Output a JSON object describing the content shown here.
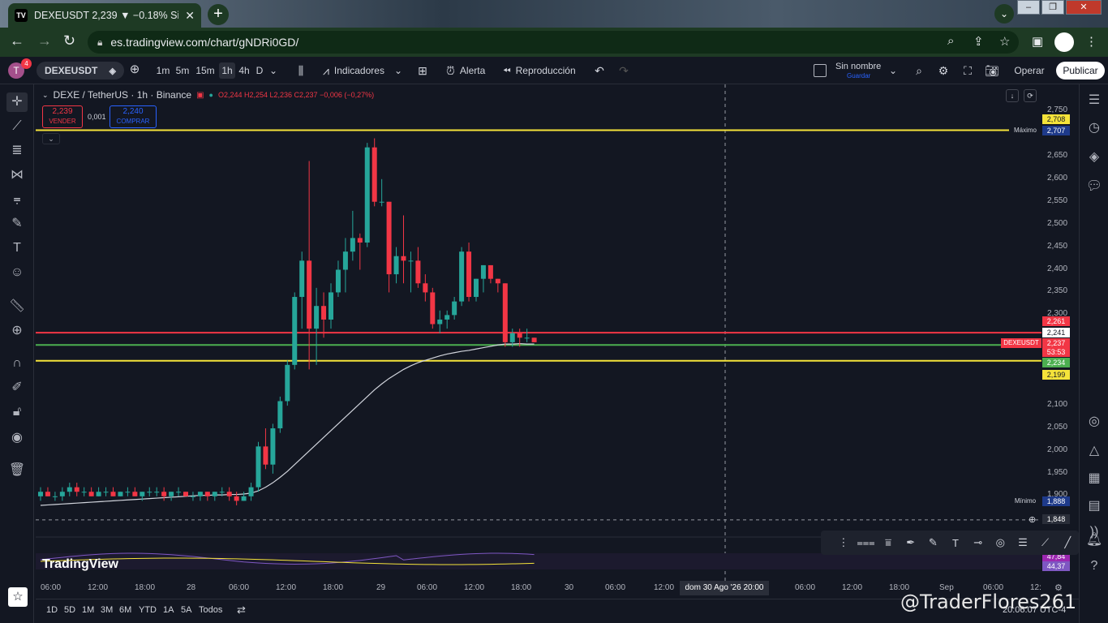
{
  "browser": {
    "tab_title": "DEXEUSDT 2,239 ▼ −0.18% Sin n",
    "url": "es.tradingview.com/chart/gNDRi0GD/"
  },
  "toolbar": {
    "avatar_letter": "T",
    "notifications": "4",
    "symbol": "DEXEUSDT",
    "timeframes": [
      "1m",
      "5m",
      "15m",
      "1h",
      "4h",
      "D"
    ],
    "indicators_label": "Indicadores",
    "alert_label": "Alerta",
    "replay_label": "Reproducción",
    "layout_name": "Sin nombre",
    "layout_save": "Guardar",
    "operar_label": "Operar",
    "publicar_label": "Publicar"
  },
  "legend": {
    "symbol": "DEXE / TetherUS · 1h · Binance",
    "ohlc": "O2,244 H2,254 L2,236 C2,237 −0,006 (−0,27%)",
    "sell_price": "2,239",
    "sell_label": "VENDER",
    "spread": "0,001",
    "buy_price": "2,240",
    "buy_label": "COMPRAR"
  },
  "price_axis": {
    "ticks": [
      "2,750",
      "2,650",
      "2,600",
      "2,550",
      "2,500",
      "2,450",
      "2,400",
      "2,350",
      "2,300",
      "2,100",
      "2,050",
      "2,000",
      "1,950",
      "1,900"
    ],
    "labels": {
      "upper_line": "2,708",
      "max": "2,707",
      "max_text": "Máximo",
      "red_line": "2,261",
      "crosshair": "2,241",
      "last": "2,237",
      "countdown": "53:53",
      "ma": "2,234",
      "lower_line": "2,199",
      "min": "1,888",
      "min_text": "Mínimo",
      "cursor": "1,848",
      "osc_1": "47,84",
      "osc_2": "44,37",
      "symbol_tag": "DEXEUSDT"
    }
  },
  "time_axis": {
    "ticks": [
      "06:00",
      "12:00",
      "18:00",
      "28",
      "06:00",
      "12:00",
      "18:00",
      "29",
      "06:00",
      "12:00",
      "18:00",
      "30",
      "06:00",
      "12:00",
      "dom 30 Ago '26",
      "20:00",
      "06:00",
      "12:00",
      "18:00",
      "Sep",
      "06:00",
      "12:"
    ],
    "crosshair": "dom 30 Ago '26   20:00"
  },
  "ranges": [
    "1D",
    "5D",
    "1M",
    "3M",
    "6M",
    "YTD",
    "1A",
    "5A",
    "Todos"
  ],
  "branding": {
    "logo": "TradingView",
    "watermark": "@TraderFlores261",
    "clock": "20:06:07 UTC-4"
  },
  "colors": {
    "up": "#26a69a",
    "down": "#f23645",
    "yellow_line": "#f5e33a",
    "red_line": "#f23645",
    "green_line": "#4caf50",
    "ma": "#d1d4dc"
  },
  "chart_data": {
    "type": "candlestick",
    "interval": "1h",
    "ylim": [
      1.848,
      2.75
    ],
    "candles": [
      {
        "o": 1.9,
        "h": 1.92,
        "l": 1.89,
        "c": 1.91
      },
      {
        "o": 1.91,
        "h": 1.92,
        "l": 1.9,
        "c": 1.9
      },
      {
        "o": 1.9,
        "h": 1.91,
        "l": 1.89,
        "c": 1.9
      },
      {
        "o": 1.9,
        "h": 1.92,
        "l": 1.89,
        "c": 1.91
      },
      {
        "o": 1.91,
        "h": 1.93,
        "l": 1.9,
        "c": 1.92
      },
      {
        "o": 1.92,
        "h": 1.93,
        "l": 1.9,
        "c": 1.91
      },
      {
        "o": 1.91,
        "h": 1.92,
        "l": 1.9,
        "c": 1.91
      },
      {
        "o": 1.91,
        "h": 1.92,
        "l": 1.9,
        "c": 1.9
      },
      {
        "o": 1.9,
        "h": 1.92,
        "l": 1.9,
        "c": 1.91
      },
      {
        "o": 1.91,
        "h": 1.92,
        "l": 1.9,
        "c": 1.91
      },
      {
        "o": 1.91,
        "h": 1.92,
        "l": 1.9,
        "c": 1.9
      },
      {
        "o": 1.9,
        "h": 1.91,
        "l": 1.9,
        "c": 1.91
      },
      {
        "o": 1.91,
        "h": 1.92,
        "l": 1.9,
        "c": 1.91
      },
      {
        "o": 1.91,
        "h": 1.92,
        "l": 1.9,
        "c": 1.9
      },
      {
        "o": 1.9,
        "h": 1.91,
        "l": 1.89,
        "c": 1.91
      },
      {
        "o": 1.91,
        "h": 1.92,
        "l": 1.9,
        "c": 1.91
      },
      {
        "o": 1.91,
        "h": 1.92,
        "l": 1.9,
        "c": 1.91
      },
      {
        "o": 1.91,
        "h": 1.92,
        "l": 1.89,
        "c": 1.9
      },
      {
        "o": 1.9,
        "h": 1.91,
        "l": 1.89,
        "c": 1.91
      },
      {
        "o": 1.91,
        "h": 1.92,
        "l": 1.9,
        "c": 1.91
      },
      {
        "o": 1.91,
        "h": 1.91,
        "l": 1.9,
        "c": 1.9
      },
      {
        "o": 1.9,
        "h": 1.91,
        "l": 1.89,
        "c": 1.9
      },
      {
        "o": 1.9,
        "h": 1.91,
        "l": 1.89,
        "c": 1.91
      },
      {
        "o": 1.91,
        "h": 1.91,
        "l": 1.89,
        "c": 1.9
      },
      {
        "o": 1.9,
        "h": 1.91,
        "l": 1.89,
        "c": 1.91
      },
      {
        "o": 1.91,
        "h": 1.92,
        "l": 1.9,
        "c": 1.91
      },
      {
        "o": 1.91,
        "h": 1.92,
        "l": 1.89,
        "c": 1.9
      },
      {
        "o": 1.9,
        "h": 1.91,
        "l": 1.88,
        "c": 1.89
      },
      {
        "o": 1.89,
        "h": 1.91,
        "l": 1.89,
        "c": 1.9
      },
      {
        "o": 1.9,
        "h": 1.93,
        "l": 1.89,
        "c": 1.92
      },
      {
        "o": 1.92,
        "h": 2.02,
        "l": 1.91,
        "c": 2.01
      },
      {
        "o": 2.01,
        "h": 2.05,
        "l": 1.96,
        "c": 1.97
      },
      {
        "o": 1.97,
        "h": 2.06,
        "l": 1.95,
        "c": 2.05
      },
      {
        "o": 2.05,
        "h": 2.12,
        "l": 2.04,
        "c": 2.11
      },
      {
        "o": 2.11,
        "h": 2.2,
        "l": 2.1,
        "c": 2.19
      },
      {
        "o": 2.19,
        "h": 2.35,
        "l": 2.18,
        "c": 2.34
      },
      {
        "o": 2.34,
        "h": 2.44,
        "l": 2.27,
        "c": 2.42
      },
      {
        "o": 2.42,
        "h": 2.64,
        "l": 2.18,
        "c": 2.27
      },
      {
        "o": 2.27,
        "h": 2.36,
        "l": 2.19,
        "c": 2.32
      },
      {
        "o": 2.32,
        "h": 2.35,
        "l": 2.25,
        "c": 2.29
      },
      {
        "o": 2.29,
        "h": 2.37,
        "l": 2.27,
        "c": 2.35
      },
      {
        "o": 2.35,
        "h": 2.42,
        "l": 2.34,
        "c": 2.4
      },
      {
        "o": 2.4,
        "h": 2.47,
        "l": 2.35,
        "c": 2.44
      },
      {
        "o": 2.44,
        "h": 2.53,
        "l": 2.42,
        "c": 2.47
      },
      {
        "o": 2.47,
        "h": 2.48,
        "l": 2.4,
        "c": 2.46
      },
      {
        "o": 2.46,
        "h": 2.68,
        "l": 2.45,
        "c": 2.67
      },
      {
        "o": 2.67,
        "h": 2.69,
        "l": 2.54,
        "c": 2.55
      },
      {
        "o": 2.55,
        "h": 2.6,
        "l": 2.54,
        "c": 2.55
      },
      {
        "o": 2.55,
        "h": 2.55,
        "l": 2.35,
        "c": 2.39
      },
      {
        "o": 2.39,
        "h": 2.45,
        "l": 2.37,
        "c": 2.43
      },
      {
        "o": 2.43,
        "h": 2.52,
        "l": 2.37,
        "c": 2.42
      },
      {
        "o": 2.42,
        "h": 2.44,
        "l": 2.35,
        "c": 2.42
      },
      {
        "o": 2.42,
        "h": 2.45,
        "l": 2.36,
        "c": 2.37
      },
      {
        "o": 2.37,
        "h": 2.39,
        "l": 2.33,
        "c": 2.35
      },
      {
        "o": 2.35,
        "h": 2.36,
        "l": 2.27,
        "c": 2.28
      },
      {
        "o": 2.28,
        "h": 2.31,
        "l": 2.26,
        "c": 2.29
      },
      {
        "o": 2.29,
        "h": 2.31,
        "l": 2.27,
        "c": 2.3
      },
      {
        "o": 2.3,
        "h": 2.34,
        "l": 2.29,
        "c": 2.33
      },
      {
        "o": 2.33,
        "h": 2.45,
        "l": 2.32,
        "c": 2.44
      },
      {
        "o": 2.44,
        "h": 2.46,
        "l": 2.33,
        "c": 2.34
      },
      {
        "o": 2.34,
        "h": 2.38,
        "l": 2.33,
        "c": 2.38
      },
      {
        "o": 2.38,
        "h": 2.41,
        "l": 2.35,
        "c": 2.41
      },
      {
        "o": 2.41,
        "h": 2.41,
        "l": 2.37,
        "c": 2.38
      },
      {
        "o": 2.38,
        "h": 2.38,
        "l": 2.35,
        "c": 2.37
      },
      {
        "o": 2.37,
        "h": 2.37,
        "l": 2.23,
        "c": 2.24
      },
      {
        "o": 2.24,
        "h": 2.27,
        "l": 2.23,
        "c": 2.26
      },
      {
        "o": 2.26,
        "h": 2.27,
        "l": 2.23,
        "c": 2.25
      },
      {
        "o": 2.25,
        "h": 2.27,
        "l": 2.24,
        "c": 2.25
      },
      {
        "o": 2.25,
        "h": 2.25,
        "l": 2.24,
        "c": 2.24
      }
    ],
    "ma_values": [
      1.88,
      1.881,
      1.882,
      1.883,
      1.884,
      1.885,
      1.886,
      1.887,
      1.888,
      1.889,
      1.89,
      1.891,
      1.892,
      1.893,
      1.894,
      1.895,
      1.896,
      1.897,
      1.898,
      1.899,
      1.9,
      1.901,
      1.902,
      1.902,
      1.903,
      1.903,
      1.904,
      1.904,
      1.905,
      1.907,
      1.912,
      1.92,
      1.93,
      1.942,
      1.955,
      1.97,
      1.985,
      2.0,
      2.015,
      2.03,
      2.045,
      2.06,
      2.075,
      2.09,
      2.105,
      2.12,
      2.135,
      2.148,
      2.16,
      2.17,
      2.18,
      2.188,
      2.195,
      2.2,
      2.205,
      2.21,
      2.214,
      2.217,
      2.22,
      2.222,
      2.225,
      2.228,
      2.231,
      2.234,
      2.236,
      2.236,
      2.237,
      2.236,
      2.236
    ],
    "horizontal_lines": [
      {
        "price": 2.708,
        "color": "yellow"
      },
      {
        "price": 2.261,
        "color": "red"
      },
      {
        "price": 2.234,
        "color": "green"
      },
      {
        "price": 2.199,
        "color": "yellow"
      }
    ],
    "oscillator": {
      "values": [
        47.84,
        44.37
      ]
    }
  }
}
